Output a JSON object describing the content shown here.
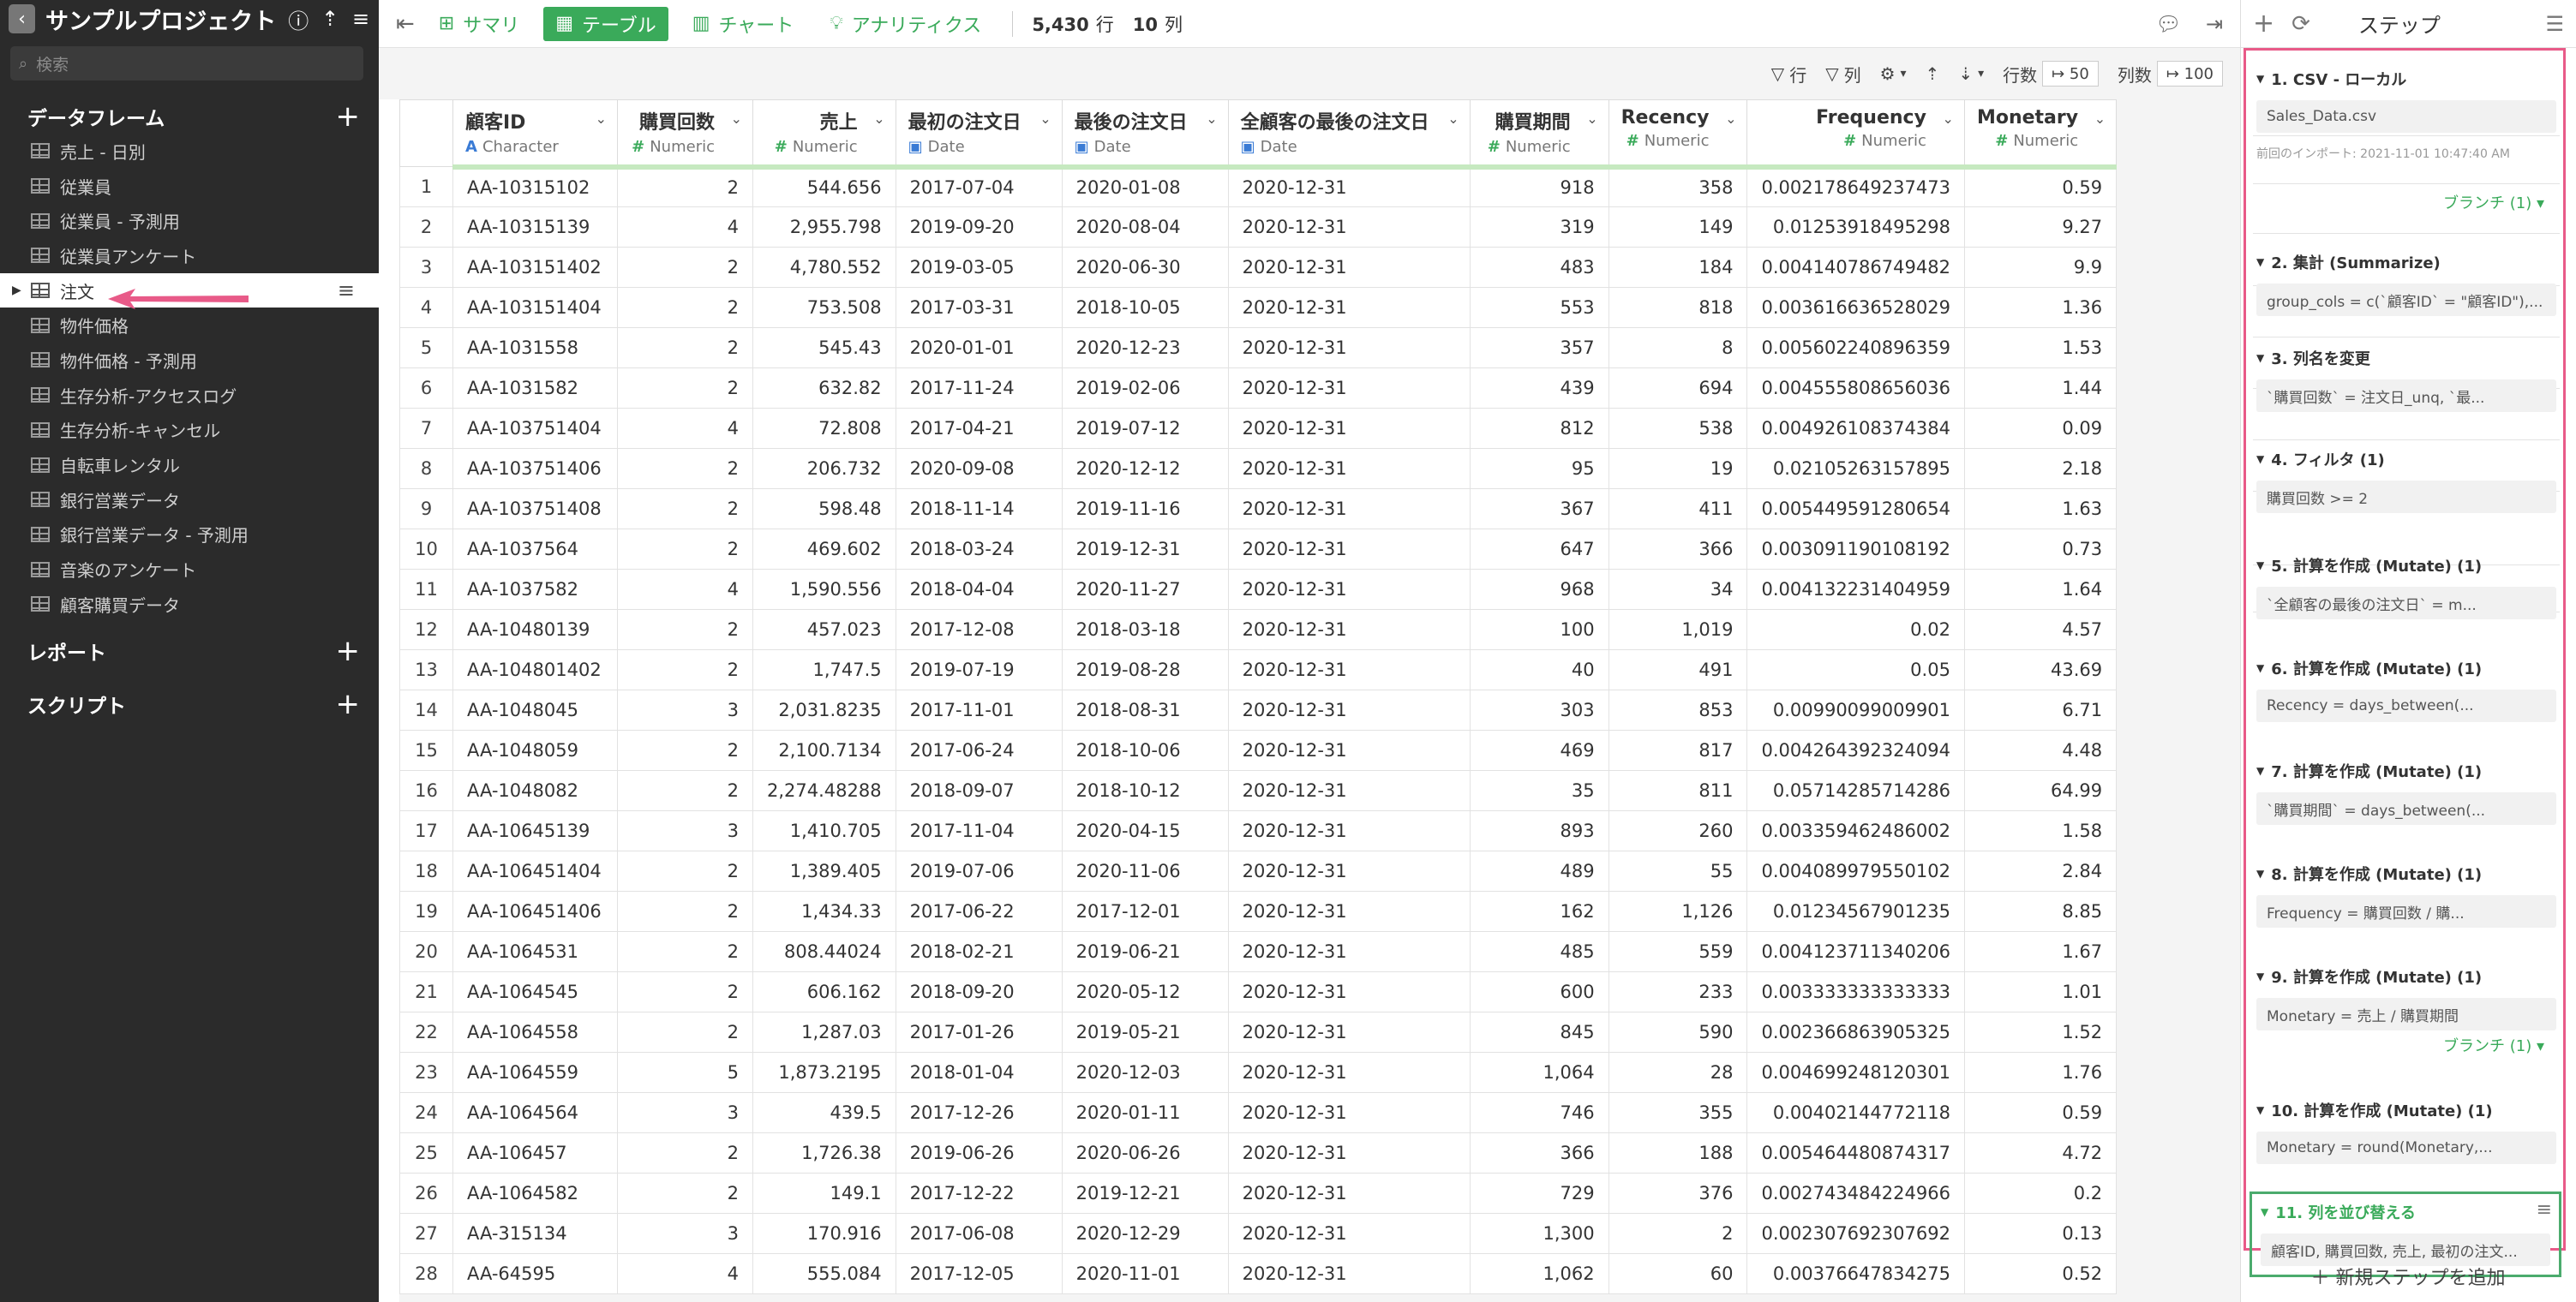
{
  "sidebar": {
    "project_title": "サンプルプロジェクト",
    "search_placeholder": "検索",
    "sections": {
      "dataframes": "データフレーム",
      "reports": "レポート",
      "scripts": "スクリプト"
    },
    "items": [
      {
        "label": "売上 - 日別"
      },
      {
        "label": "従業員"
      },
      {
        "label": "従業員 - 予測用"
      },
      {
        "label": "従業員アンケート"
      },
      {
        "label": "注文"
      },
      {
        "label": "物件価格"
      },
      {
        "label": "物件価格 - 予測用"
      },
      {
        "label": "生存分析-アクセスログ"
      },
      {
        "label": "生存分析-キャンセル"
      },
      {
        "label": "自転車レンタル"
      },
      {
        "label": "銀行営業データ"
      },
      {
        "label": "銀行営業データ - 予測用"
      },
      {
        "label": "音楽のアンケート"
      },
      {
        "label": "顧客購買データ"
      }
    ],
    "selected_index": 4,
    "accent_color": "#e85a88"
  },
  "toolbar": {
    "tabs": [
      {
        "label": "サマリ",
        "icon": "summary-icon"
      },
      {
        "label": "テーブル",
        "icon": "table-icon"
      },
      {
        "label": "チャート",
        "icon": "chart-icon"
      },
      {
        "label": "アナリティクス",
        "icon": "analytics-icon"
      }
    ],
    "active_tab": 1,
    "row_count": "5,430",
    "row_unit": "行",
    "col_count": "10",
    "col_unit": "列"
  },
  "filterbar": {
    "row_filter": "行",
    "col_filter": "列",
    "rows_label": "行数",
    "rows_value": "50",
    "cols_label": "列数",
    "cols_value": "100"
  },
  "table": {
    "columns": [
      {
        "name": "顧客ID",
        "type": "Character",
        "align": "left"
      },
      {
        "name": "購買回数",
        "type": "Numeric",
        "align": "right"
      },
      {
        "name": "売上",
        "type": "Numeric",
        "align": "right"
      },
      {
        "name": "最初の注文日",
        "type": "Date",
        "align": "left"
      },
      {
        "name": "最後の注文日",
        "type": "Date",
        "align": "left"
      },
      {
        "name": "全顧客の最後の注文日",
        "type": "Date",
        "align": "left"
      },
      {
        "name": "購買期間",
        "type": "Numeric",
        "align": "right"
      },
      {
        "name": "Recency",
        "type": "Numeric",
        "align": "right"
      },
      {
        "name": "Frequency",
        "type": "Numeric",
        "align": "right"
      },
      {
        "name": "Monetary",
        "type": "Numeric",
        "align": "right"
      }
    ],
    "rows": [
      [
        "1",
        "AA-10315102",
        "2",
        "544.656",
        "2017-07-04",
        "2020-01-08",
        "2020-12-31",
        "918",
        "358",
        "0.002178649237473",
        "0.59"
      ],
      [
        "2",
        "AA-10315139",
        "4",
        "2,955.798",
        "2019-09-20",
        "2020-08-04",
        "2020-12-31",
        "319",
        "149",
        "0.01253918495298",
        "9.27"
      ],
      [
        "3",
        "AA-103151402",
        "2",
        "4,780.552",
        "2019-03-05",
        "2020-06-30",
        "2020-12-31",
        "483",
        "184",
        "0.004140786749482",
        "9.9"
      ],
      [
        "4",
        "AA-103151404",
        "2",
        "753.508",
        "2017-03-31",
        "2018-10-05",
        "2020-12-31",
        "553",
        "818",
        "0.003616636528029",
        "1.36"
      ],
      [
        "5",
        "AA-1031558",
        "2",
        "545.43",
        "2020-01-01",
        "2020-12-23",
        "2020-12-31",
        "357",
        "8",
        "0.005602240896359",
        "1.53"
      ],
      [
        "6",
        "AA-1031582",
        "2",
        "632.82",
        "2017-11-24",
        "2019-02-06",
        "2020-12-31",
        "439",
        "694",
        "0.004555808656036",
        "1.44"
      ],
      [
        "7",
        "AA-103751404",
        "4",
        "72.808",
        "2017-04-21",
        "2019-07-12",
        "2020-12-31",
        "812",
        "538",
        "0.004926108374384",
        "0.09"
      ],
      [
        "8",
        "AA-103751406",
        "2",
        "206.732",
        "2020-09-08",
        "2020-12-12",
        "2020-12-31",
        "95",
        "19",
        "0.02105263157895",
        "2.18"
      ],
      [
        "9",
        "AA-103751408",
        "2",
        "598.48",
        "2018-11-14",
        "2019-11-16",
        "2020-12-31",
        "367",
        "411",
        "0.005449591280654",
        "1.63"
      ],
      [
        "10",
        "AA-1037564",
        "2",
        "469.602",
        "2018-03-24",
        "2019-12-31",
        "2020-12-31",
        "647",
        "366",
        "0.003091190108192",
        "0.73"
      ],
      [
        "11",
        "AA-1037582",
        "4",
        "1,590.556",
        "2018-04-04",
        "2020-11-27",
        "2020-12-31",
        "968",
        "34",
        "0.004132231404959",
        "1.64"
      ],
      [
        "12",
        "AA-10480139",
        "2",
        "457.023",
        "2017-12-08",
        "2018-03-18",
        "2020-12-31",
        "100",
        "1,019",
        "0.02",
        "4.57"
      ],
      [
        "13",
        "AA-104801402",
        "2",
        "1,747.5",
        "2019-07-19",
        "2019-08-28",
        "2020-12-31",
        "40",
        "491",
        "0.05",
        "43.69"
      ],
      [
        "14",
        "AA-1048045",
        "3",
        "2,031.8235",
        "2017-11-01",
        "2018-08-31",
        "2020-12-31",
        "303",
        "853",
        "0.00990099009901",
        "6.71"
      ],
      [
        "15",
        "AA-1048059",
        "2",
        "2,100.7134",
        "2017-06-24",
        "2018-10-06",
        "2020-12-31",
        "469",
        "817",
        "0.004264392324094",
        "4.48"
      ],
      [
        "16",
        "AA-1048082",
        "2",
        "2,274.48288",
        "2018-09-07",
        "2018-10-12",
        "2020-12-31",
        "35",
        "811",
        "0.05714285714286",
        "64.99"
      ],
      [
        "17",
        "AA-10645139",
        "3",
        "1,410.705",
        "2017-11-04",
        "2020-04-15",
        "2020-12-31",
        "893",
        "260",
        "0.003359462486002",
        "1.58"
      ],
      [
        "18",
        "AA-106451404",
        "2",
        "1,389.405",
        "2019-07-06",
        "2020-11-06",
        "2020-12-31",
        "489",
        "55",
        "0.004089979550102",
        "2.84"
      ],
      [
        "19",
        "AA-106451406",
        "2",
        "1,434.33",
        "2017-06-22",
        "2017-12-01",
        "2020-12-31",
        "162",
        "1,126",
        "0.01234567901235",
        "8.85"
      ],
      [
        "20",
        "AA-1064531",
        "2",
        "808.44024",
        "2018-02-21",
        "2019-06-21",
        "2020-12-31",
        "485",
        "559",
        "0.004123711340206",
        "1.67"
      ],
      [
        "21",
        "AA-1064545",
        "2",
        "606.162",
        "2018-09-20",
        "2020-05-12",
        "2020-12-31",
        "600",
        "233",
        "0.003333333333333",
        "1.01"
      ],
      [
        "22",
        "AA-1064558",
        "2",
        "1,287.03",
        "2017-01-26",
        "2019-05-21",
        "2020-12-31",
        "845",
        "590",
        "0.002366863905325",
        "1.52"
      ],
      [
        "23",
        "AA-1064559",
        "5",
        "1,873.2195",
        "2018-01-04",
        "2020-12-03",
        "2020-12-31",
        "1,064",
        "28",
        "0.004699248120301",
        "1.76"
      ],
      [
        "24",
        "AA-1064564",
        "3",
        "439.5",
        "2017-12-26",
        "2020-01-11",
        "2020-12-31",
        "746",
        "355",
        "0.00402144772118",
        "0.59"
      ],
      [
        "25",
        "AA-106457",
        "2",
        "1,726.38",
        "2019-06-26",
        "2020-06-26",
        "2020-12-31",
        "366",
        "188",
        "0.005464480874317",
        "4.72"
      ],
      [
        "26",
        "AA-1064582",
        "2",
        "149.1",
        "2017-12-22",
        "2019-12-21",
        "2020-12-31",
        "729",
        "376",
        "0.002743484224966",
        "0.2"
      ],
      [
        "27",
        "AA-315134",
        "3",
        "170.916",
        "2017-06-08",
        "2020-12-29",
        "2020-12-31",
        "1,300",
        "2",
        "0.002307692307692",
        "0.13"
      ],
      [
        "28",
        "AA-64595",
        "4",
        "555.084",
        "2017-12-05",
        "2020-11-01",
        "2020-12-31",
        "1,062",
        "60",
        "0.00376647834275",
        "0.52"
      ]
    ]
  },
  "steps": {
    "title": "ステップ",
    "items": [
      {
        "title": "1. CSV - ローカル",
        "content": "Sales_Data.csv",
        "sub": "前回のインポート: 2021-11-01 10:47:40 AM",
        "branch": "ブランチ (1)"
      },
      {
        "title": "2. 集計 (Summarize)",
        "content": "group_cols = c(`顧客ID` = \"顧客ID\"),..."
      },
      {
        "title": "3. 列名を変更",
        "content": "`購買回数` = 注文日_unq, `最..."
      },
      {
        "title": "4. フィルタ (1)",
        "content": "購買回数 >= 2"
      },
      {
        "title": "5. 計算を作成 (Mutate) (1)",
        "content": "`全顧客の最後の注文日` = m..."
      },
      {
        "title": "6. 計算を作成 (Mutate) (1)",
        "content": "Recency = days_between(..."
      },
      {
        "title": "7. 計算を作成 (Mutate) (1)",
        "content": "`購買期間` = days_between(..."
      },
      {
        "title": "8. 計算を作成 (Mutate) (1)",
        "content": "Frequency = 購買回数 / 購..."
      },
      {
        "title": "9. 計算を作成 (Mutate) (1)",
        "content": "Monetary = 売上 / 購買期間",
        "branch": "ブランチ (1)"
      },
      {
        "title": "10. 計算を作成 (Mutate) (1)",
        "content": "Monetary = round(Monetary,..."
      },
      {
        "title": "11. 列を並び替える",
        "content": "顧客ID, 購買回数, 売上, 最初の注文..."
      }
    ],
    "new_step_label": "新規ステップを追加",
    "active_color": "#4bab6d",
    "frame_color": "#e85a88"
  }
}
